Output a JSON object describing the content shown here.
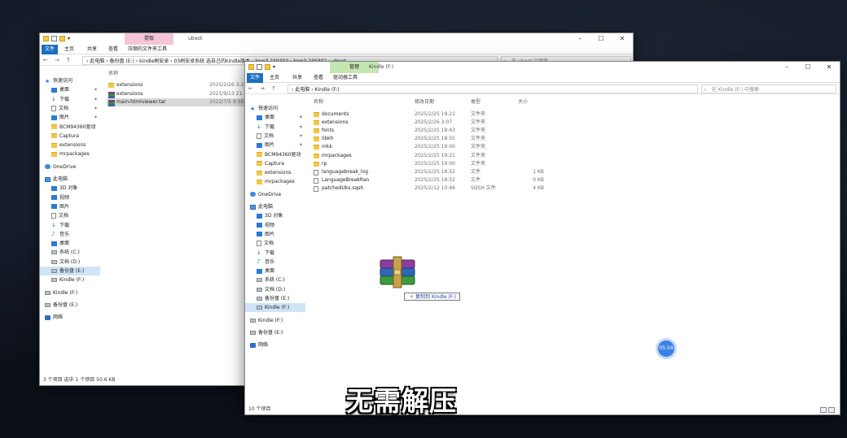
{
  "back_window": {
    "ribbon_context_label": "提取",
    "title": "uboot",
    "tabs": [
      "文件",
      "主页",
      "共享",
      "查看",
      "压缩的文件夹工具"
    ],
    "path": "›  此电脑  ›  备份盘 (E:)  ›  kindle刷安卓  ›  03刷安卓系统 选自己的kindle版本  ›  kpw3 230302  ›  kpw3 230302  ›  uboot",
    "search_placeholder": "在 uboot 中搜索",
    "quick_access": "快速访问",
    "nav": [
      {
        "label": "桌面",
        "icon": "blue"
      },
      {
        "label": "下载",
        "icon": "dl"
      },
      {
        "label": "文档",
        "icon": "file"
      },
      {
        "label": "图片",
        "icon": "blue"
      },
      {
        "label": "BCM94360驱动",
        "icon": "folder"
      },
      {
        "label": "Captura",
        "icon": "folder"
      },
      {
        "label": "extensions",
        "icon": "folder"
      },
      {
        "label": "mrpackages",
        "icon": "folder"
      }
    ],
    "onedrive": "OneDrive",
    "this_pc": "此电脑",
    "pc_items": [
      {
        "label": "3D 对象",
        "icon": "blue"
      },
      {
        "label": "视频",
        "icon": "blue"
      },
      {
        "label": "图片",
        "icon": "blue"
      },
      {
        "label": "文档",
        "icon": "file"
      },
      {
        "label": "下载",
        "icon": "dl"
      },
      {
        "label": "音乐",
        "icon": "music"
      },
      {
        "label": "桌面",
        "icon": "blue"
      },
      {
        "label": "系统 (C:)",
        "icon": "drive"
      },
      {
        "label": "文档 (D:)",
        "icon": "drive"
      },
      {
        "label": "备份盘 (E:)",
        "icon": "drive"
      },
      {
        "label": "Kindle (F:)",
        "icon": "drive"
      }
    ],
    "kindle": "Kindle (F:)",
    "backup": "备份盘 (E:)",
    "network": "网络",
    "header_name": "名称",
    "files": [
      {
        "name": "extensions",
        "date": "2025/2/26 3:28",
        "icon": "folder"
      },
      {
        "name": "extensions",
        "date": "2021/9/13 21:12",
        "icon": "tar"
      },
      {
        "name": "main-htmlviewer.tar",
        "date": "2022/7/5 9:50",
        "icon": "tar"
      }
    ],
    "status": "3 个项目    选中 1 个项目  50.6 KB"
  },
  "front_window": {
    "ribbon_context_label": "管理",
    "title": "Kindle (F:)",
    "tabs": [
      "文件",
      "主页",
      "共享",
      "查看",
      "驱动器工具"
    ],
    "path": "›  此电脑  ›  Kindle (F:)",
    "search_placeholder": "在 Kindle (F:) 中搜索",
    "quick_access": "快速访问",
    "nav": [
      {
        "label": "桌面",
        "icon": "blue"
      },
      {
        "label": "下载",
        "icon": "dl"
      },
      {
        "label": "文档",
        "icon": "file"
      },
      {
        "label": "图片",
        "icon": "blue"
      },
      {
        "label": "BCM94360驱动",
        "icon": "folder"
      },
      {
        "label": "Captura",
        "icon": "folder"
      },
      {
        "label": "extensions",
        "icon": "folder"
      },
      {
        "label": "mrpackages",
        "icon": "folder"
      }
    ],
    "onedrive": "OneDrive",
    "this_pc": "此电脑",
    "pc_items": [
      {
        "label": "3D 对象",
        "icon": "blue"
      },
      {
        "label": "视频",
        "icon": "blue"
      },
      {
        "label": "图片",
        "icon": "blue"
      },
      {
        "label": "文档",
        "icon": "file"
      },
      {
        "label": "下载",
        "icon": "dl"
      },
      {
        "label": "音乐",
        "icon": "music"
      },
      {
        "label": "桌面",
        "icon": "blue"
      },
      {
        "label": "系统 (C:)",
        "icon": "drive"
      },
      {
        "label": "文档 (D:)",
        "icon": "drive"
      },
      {
        "label": "备份盘 (E:)",
        "icon": "drive"
      },
      {
        "label": "Kindle (F:)",
        "icon": "drive"
      }
    ],
    "kindle": "Kindle (F:)",
    "backup": "备份盘 (E:)",
    "network": "网络",
    "headers": {
      "name": "名称",
      "date": "修改日期",
      "type": "类型",
      "size": "大小"
    },
    "files": [
      {
        "name": "documents",
        "date": "2025/2/25 19:21",
        "type": "文件夹",
        "size": "",
        "icon": "folder"
      },
      {
        "name": "extensions",
        "date": "2025/2/26 3:07",
        "type": "文件夹",
        "size": "",
        "icon": "folder"
      },
      {
        "name": "fonts",
        "date": "2025/2/25 18:43",
        "type": "文件夹",
        "size": "",
        "icon": "folder"
      },
      {
        "name": "libkh",
        "date": "2025/2/25 18:55",
        "type": "文件夹",
        "size": "",
        "icon": "folder"
      },
      {
        "name": "mkk",
        "date": "2025/2/25 19:00",
        "type": "文件夹",
        "size": "",
        "icon": "folder"
      },
      {
        "name": "mrpackages",
        "date": "2025/2/25 19:21",
        "type": "文件夹",
        "size": "",
        "icon": "folder"
      },
      {
        "name": "rp",
        "date": "2025/2/25 19:00",
        "type": "文件夹",
        "size": "",
        "icon": "folder"
      },
      {
        "name": "languagebreak_log",
        "date": "2025/2/25 18:52",
        "type": "文件",
        "size": "1 KB",
        "icon": "file"
      },
      {
        "name": "LanguageBreakRan",
        "date": "2025/2/25 18:52",
        "type": "文件",
        "size": "0 KB",
        "icon": "file"
      },
      {
        "name": "patchedUks.sqsh",
        "date": "2025/2/12 10:46",
        "type": "SQSH 文件",
        "size": "4 KB",
        "icon": "file"
      }
    ],
    "status": "10 个项目"
  },
  "drag_tooltip": "复制到 Kindle (F:)",
  "timer_label": "05:59",
  "caption": "无需解压",
  "colors": {
    "accent": "#1a6fc1",
    "context_back": "#f3c5d6",
    "context_front": "#c4e6b2",
    "timer": "#3b82e6"
  }
}
